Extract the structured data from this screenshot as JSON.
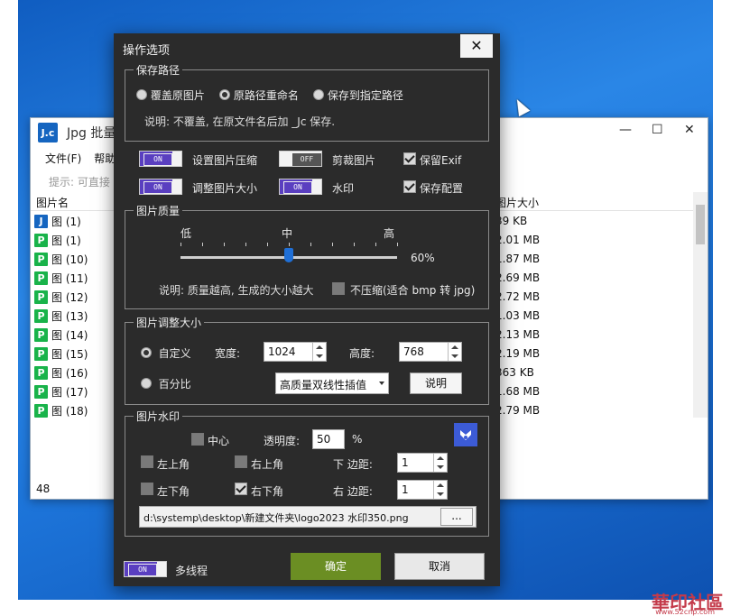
{
  "bg_window": {
    "icon_text": "J.c",
    "title": "Jpg 批量",
    "controls": [
      "—",
      "☐",
      "✕"
    ],
    "menu": [
      "文件(F)",
      "帮助"
    ],
    "hint": "提示: 可直接",
    "col_name": "图片名",
    "col_size": "图片大小",
    "files": [
      {
        "name": "图 (1)",
        "icon": "J",
        "size": "39 KB"
      },
      {
        "name": "图 (1)",
        "icon": "P",
        "size": "2.01 MB"
      },
      {
        "name": "图 (10)",
        "icon": "P",
        "size": "1.87 MB"
      },
      {
        "name": "图 (11)",
        "icon": "P",
        "size": "2.69 MB"
      },
      {
        "name": "图 (12)",
        "icon": "P",
        "size": "2.72 MB"
      },
      {
        "name": "图 (13)",
        "icon": "P",
        "size": "1.03 MB"
      },
      {
        "name": "图 (14)",
        "icon": "P",
        "size": "2.13 MB"
      },
      {
        "name": "图 (15)",
        "icon": "P",
        "size": "2.19 MB"
      },
      {
        "name": "图 (16)",
        "icon": "P",
        "size": "363 KB"
      },
      {
        "name": "图 (17)",
        "icon": "P",
        "size": "1.68 MB"
      },
      {
        "name": "图 (18)",
        "icon": "P",
        "size": "2.79 MB"
      }
    ],
    "status": "48"
  },
  "dialog": {
    "title": "操作选项",
    "close": "✕",
    "save_path": {
      "legend": "保存路径",
      "options": [
        "覆盖原图片",
        "原路径重命名",
        "保存到指定路径"
      ],
      "selected": 1,
      "note": "说明: 不覆盖, 在原文件名后加 _Jc 保存."
    },
    "toggles": {
      "compress": {
        "state": "ON",
        "label": "设置图片压缩"
      },
      "crop": {
        "state": "OFF",
        "label": "剪裁图片"
      },
      "resize": {
        "state": "ON",
        "label": "调整图片大小"
      },
      "watermark": {
        "state": "ON",
        "label": "水印"
      }
    },
    "checks": {
      "keep_exif": "保留Exif",
      "save_config": "保存配置"
    },
    "quality": {
      "legend": "图片质量",
      "low": "低",
      "mid": "中",
      "high": "高",
      "value": "60%",
      "level": 0.6,
      "note": "说明: 质量越高, 生成的大小越大",
      "no_compress": "不压缩(适合 bmp 转 jpg)"
    },
    "resize": {
      "legend": "图片调整大小",
      "custom": "自定义",
      "percent": "百分比",
      "width_label": "宽度:",
      "width": "1024",
      "height_label": "高度:",
      "height": "768",
      "interp": "高质量双线性插值",
      "explain": "说明"
    },
    "watermark": {
      "legend": "图片水印",
      "center": "中心",
      "opacity_label": "透明度:",
      "opacity": "50",
      "percent": "%",
      "top_left": "左上角",
      "top_right": "右上角",
      "bottom_left": "左下角",
      "bottom_right": "右下角",
      "bottom_margin_label": "下 边距:",
      "bottom_margin": "1",
      "right_margin_label": "右 边距:",
      "right_margin": "1",
      "path": "d:\\systemp\\desktop\\新建文件夹\\logo2023 水印350.png",
      "browse": "..."
    },
    "multithread": {
      "state": "ON",
      "label": "多线程"
    },
    "ok": "确定",
    "cancel": "取消"
  },
  "site_watermark": {
    "text": "華印社區",
    "sub": "www.52cnp.com"
  },
  "colors": {
    "dialog_bg": "#2b2b2b",
    "toggle_on": "#5a3fc0",
    "ok_button": "#6b8e23",
    "accent_blue": "#1f6fd6"
  }
}
